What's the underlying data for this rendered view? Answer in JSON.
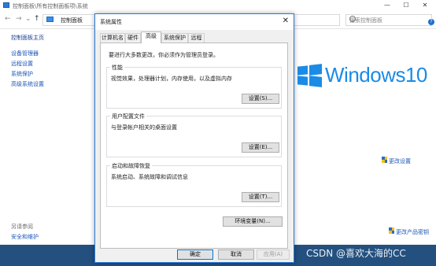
{
  "control_panel": {
    "title": "控制面板\\所有控制面板项\\系统",
    "nav_back": "←",
    "nav_forward": "→",
    "nav_recent": "⌄",
    "nav_up": "↑",
    "breadcrumb_1": "控制面板",
    "breadcrumb_sep": "›",
    "search_placeholder": "搜索控制面板",
    "help": "?",
    "left_links": {
      "home": "控制面板主页",
      "device_manager": "设备管理器",
      "remote": "远程设置",
      "protection": "系统保护",
      "advanced": "高级系统设置"
    },
    "see_also": "另请参阅",
    "security": "安全和维护",
    "change_settings": "更改设置",
    "change_key": "更改产品密钥",
    "windows_brand": "Windows10"
  },
  "window_controls": {
    "minimize": "—",
    "maximize": "☐",
    "close": "✕"
  },
  "dialog": {
    "title": "系统属性",
    "close": "✕",
    "tabs": [
      "计算机名",
      "硬件",
      "高级",
      "系统保护",
      "远程"
    ],
    "active_tab_index": 2,
    "note": "要进行大多数更改，你必须作为管理员登录。",
    "performance": {
      "legend": "性能",
      "desc": "视觉效果，处理器计划，内存使用，以及虚拟内存",
      "button": "设置(S)..."
    },
    "profiles": {
      "legend": "用户配置文件",
      "desc": "与登录帐户相关的桌面设置",
      "button": "设置(E)..."
    },
    "startup": {
      "legend": "启动和故障恢复",
      "desc": "系统启动、系统故障和调试信息",
      "button": "设置(T)..."
    },
    "env_button": "环境变量(N)...",
    "ok": "确定",
    "cancel": "取消",
    "apply": "应用(A)"
  },
  "watermark": "CSDN @喜欢大海的CC",
  "colors": {
    "accent": "#0078d7",
    "windows_blue": "#1a8be6",
    "link": "#1a56b8"
  }
}
